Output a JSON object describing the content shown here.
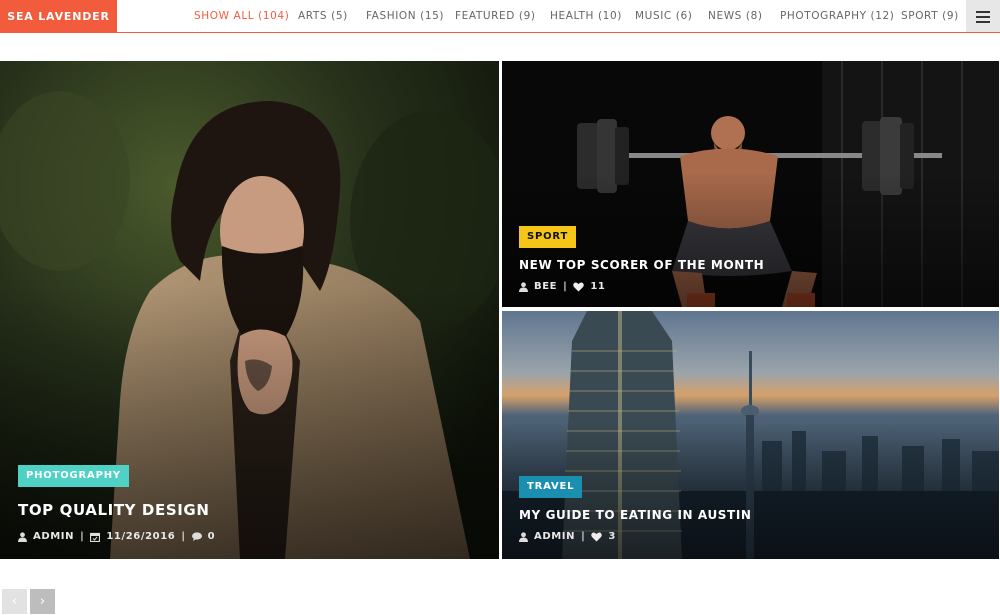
{
  "header": {
    "logo": "SEA LAVENDER",
    "nav": [
      {
        "label": "SHOW ALL (104)",
        "active": true
      },
      {
        "label": "ARTS (5)",
        "active": false
      },
      {
        "label": "FASHION (15)",
        "active": false
      },
      {
        "label": "FEATURED (9)",
        "active": false
      },
      {
        "label": "HEALTH (10)",
        "active": false
      },
      {
        "label": "MUSIC (6)",
        "active": false
      },
      {
        "label": "NEWS (8)",
        "active": false
      },
      {
        "label": "PHOTOGRAPHY (12)",
        "active": false
      },
      {
        "label": "SPORT (9)",
        "active": false
      }
    ],
    "menu_icon": "hamburger-icon"
  },
  "tiles": [
    {
      "category": "PHOTOGRAPHY",
      "category_color": "#4fd1c5",
      "title": "TOP QUALITY DESIGN",
      "author": "ADMIN",
      "date": "11/26/2016",
      "comments": "0"
    },
    {
      "category": "SPORT",
      "category_color": "#f5c518",
      "title": "NEW TOP SCORER OF THE MONTH",
      "author": "BEE",
      "likes": "11"
    },
    {
      "category": "TRAVEL",
      "category_color": "#1a8fb0",
      "title": "MY GUIDE TO EATING IN AUSTIN",
      "author": "ADMIN",
      "likes": "3"
    }
  ],
  "pagination": {
    "prev": "‹",
    "next": "›"
  },
  "colors": {
    "accent": "#f25c3c"
  }
}
